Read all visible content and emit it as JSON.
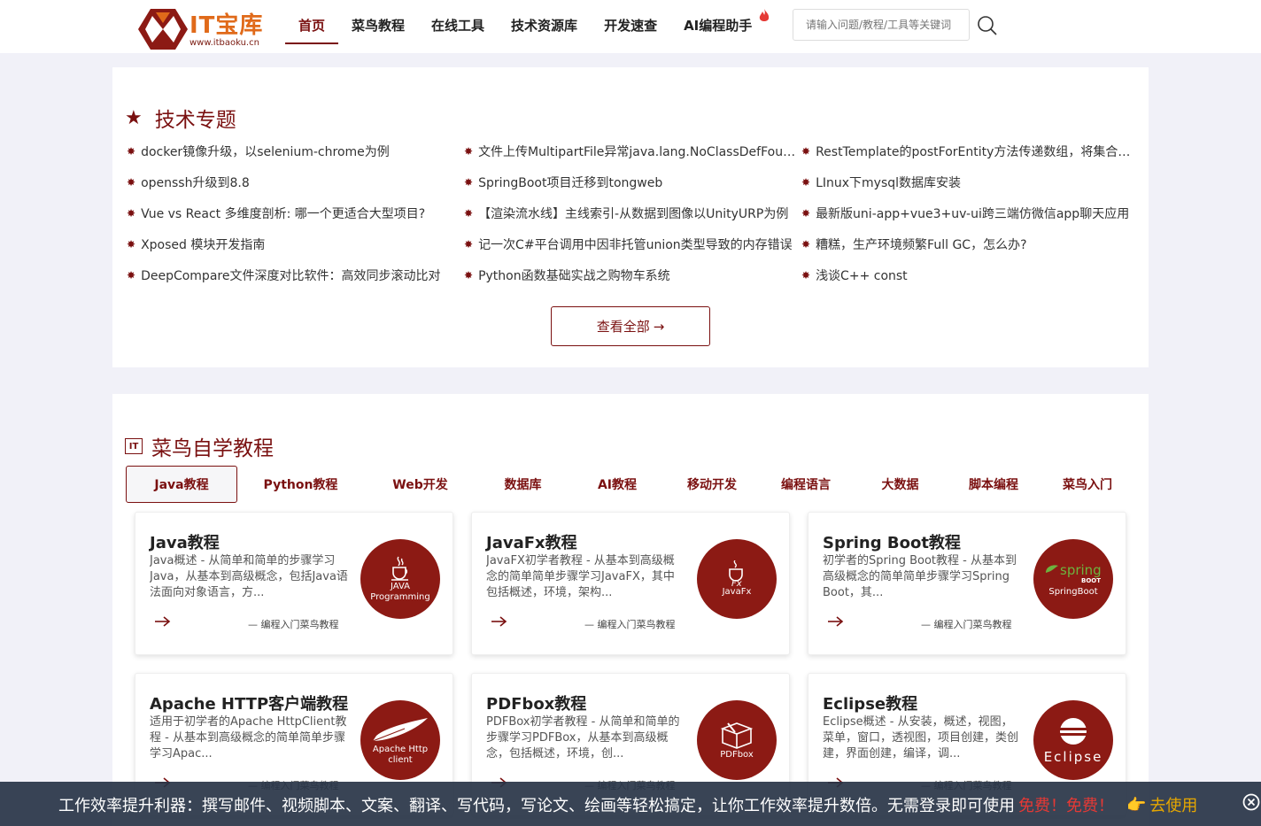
{
  "header": {
    "logo_text": "IT宝库",
    "logo_url": "www.itbaoku.cn",
    "nav": [
      {
        "label": "首页",
        "active": true
      },
      {
        "label": "菜鸟教程",
        "active": false
      },
      {
        "label": "在线工具",
        "active": false
      },
      {
        "label": "技术资源库",
        "active": false
      },
      {
        "label": "开发速查",
        "active": false
      },
      {
        "label": "AI编程助手",
        "active": false,
        "icon": "fire-icon"
      }
    ],
    "search_placeholder": "请输入问题/教程/工具等关键词"
  },
  "topics": {
    "title": "技术专题",
    "items": [
      "docker镜像升级，以selenium-chrome为例",
      "文件上传MultipartFile异常java.lang.NoClassDefFoundError",
      "RestTemplate的postForEntity方法传递数组，将集合参数",
      "openssh升级到8.8",
      "SpringBoot项目迁移到tongweb",
      "LInux下mysql数据库安装",
      "Vue vs React 多维度剖析: 哪一个更适合大型项目?",
      "【渲染流水线】主线索引-从数据到图像以UnityURP为例",
      "最新版uni-app+vue3+uv-ui跨三端仿微信app聊天应用",
      "Xposed 模块开发指南",
      "记一次C#平台调用中因非托管union类型导致的内存错误",
      "糟糕，生产环境频繁Full GC，怎么办?",
      "DeepCompare文件深度对比软件：高效同步滚动比对",
      "Python函数基础实战之购物车系统",
      "浅谈C++ const"
    ],
    "view_all": "查看全部"
  },
  "tutorials": {
    "title": "菜鸟自学教程",
    "tabs": [
      "Java教程",
      "Python教程",
      "Web开发",
      "数据库",
      "AI教程",
      "移动开发",
      "编程语言",
      "大数据",
      "脚本编程",
      "菜鸟入门"
    ],
    "active_tab": "Java教程",
    "cards": [
      {
        "title": "Java教程",
        "desc": "Java概述 - 从简单和简单的步骤学习Java，从基本到高级概念，包括Java语法面向对象语言，方...",
        "source": "— 编程入门菜鸟教程",
        "logo_caption": "JAVA Programming",
        "logo_icon": "java-cup-icon"
      },
      {
        "title": "JavaFx教程",
        "desc": "JavaFX初学者教程 - 从基本到高级概念的简单简单步骤学习JavaFX，其中包括概述，环境，架构...",
        "source": "— 编程入门菜鸟教程",
        "logo_caption": "JavaFx",
        "logo_icon": "javafx-cup-icon"
      },
      {
        "title": "Spring Boot教程",
        "desc": "初学者的Spring Boot教程 - 从基本到高级概念的简单简单步骤学习Spring Boot，其...",
        "source": "— 编程入门菜鸟教程",
        "logo_caption": "SpringBoot",
        "logo_icon": "spring-leaf-icon"
      },
      {
        "title": "Apache HTTP客户端教程",
        "desc": "适用于初学者的Apache HttpClient教程 - 从基本到高级概念的简单简单步骤学习Apac...",
        "source": "— 编程入门菜鸟教程",
        "logo_caption": "Apache Http client",
        "logo_icon": "feather-icon"
      },
      {
        "title": "PDFbox教程",
        "desc": "PDFBox初学者教程 - 从简单和简单的步骤学习PDFBox，从基本到高级概念，包括概述，环境，创...",
        "source": "— 编程入门菜鸟教程",
        "logo_caption": "PDFbox",
        "logo_icon": "pdfbox-icon"
      },
      {
        "title": "Eclipse教程",
        "desc": "Eclipse概述 - 从安装，概述，视图，菜单，窗口，透视图，项目创建，类创建，界面创建，编译，调...",
        "source": "— 编程入门菜鸟教程",
        "logo_caption": "Eclipse",
        "logo_icon": "eclipse-icon"
      }
    ]
  },
  "ad_bar": {
    "text": "工作效率提升利器：撰写邮件、视频脚本、文案、翻译、写代码，写论文、绘画等轻松搞定，让你工作效率提升数倍。无需登录即可使用",
    "free": "免费！免费！",
    "cta": "去使用"
  },
  "colors": {
    "brand": "#7a1010",
    "logo_orange": "#e06a1a",
    "card_logo_bg": "#8c1a14",
    "ad_bar_bg": "#283446",
    "ad_free": "#e53935",
    "ad_cta": "#e6a700"
  }
}
